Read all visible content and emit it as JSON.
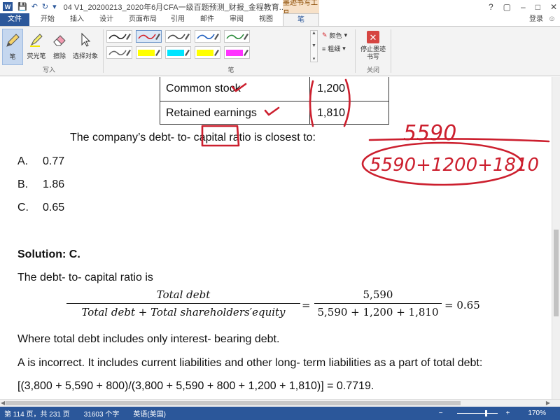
{
  "window": {
    "app_icon": "W",
    "title": "04 V1_20200213_2020年6月CFA一级百题预测_财报_金程教育...",
    "contextual_tab_group": "墨迹书写工具",
    "controls": {
      "help": "?",
      "restore": "▢",
      "minimize": "–",
      "maximize": "□",
      "close": "✕"
    }
  },
  "tabs": {
    "file": "文件",
    "items": [
      "开始",
      "插入",
      "设计",
      "页面布局",
      "引用",
      "邮件",
      "审阅",
      "视图",
      "笔"
    ],
    "login": "登录"
  },
  "ribbon": {
    "write_group": {
      "label": "写入",
      "pen": "笔",
      "highlighter": "荧光笔",
      "eraser": "擦除",
      "select": "选择对象"
    },
    "pens_group": {
      "label": "笔",
      "color": "颜色",
      "thickness": "粗细",
      "pen_colors": [
        "#222222",
        "#d42027",
        "#444444",
        "#1f5fbf",
        "#2a8a3a",
        "#666666",
        "#ffff00",
        "#00e5ff",
        "#ffff00",
        "#ff33ff"
      ]
    },
    "close_group": {
      "label": "关闭",
      "stop": "停止墨迹书写"
    }
  },
  "document": {
    "balance_sheet": [
      {
        "label": "Common stock",
        "value": "1,200"
      },
      {
        "label": "Retained earnings",
        "value": "1,810"
      }
    ],
    "question": "The company’s debt- to- capital ratio is closest to:",
    "options": [
      {
        "letter": "A.",
        "value": "0.77"
      },
      {
        "letter": "B.",
        "value": "1.86"
      },
      {
        "letter": "C.",
        "value": "0.65"
      }
    ],
    "solution_title": "Solution: C.",
    "solution_intro": "The debt- to- capital ratio is",
    "formula": {
      "num_left": "Total debt",
      "den_left": "Total debt + Total shareholders′equity",
      "num_right": "5,590",
      "den_right": "5,590 + 1,200 + 1,810",
      "equals": "=",
      "result": "= 0.65"
    },
    "note_total_debt": "Where total debt includes only interest- bearing debt.",
    "a_incorrect": "A is incorrect. It includes current liabilities and other long- term liabilities as a part of total debt:",
    "a_calc": "[(3,800 + 5,590 + 800)/(3,800 + 5,590 + 800 + 1,200 + 1,810)] = 0.7719.",
    "ink_annotations": {
      "top": "5590",
      "bottom": "5590+1200+1810"
    }
  },
  "statusbar": {
    "page": "第 114 页，共 231 页",
    "words": "31603 个字",
    "language": "英语(美国)",
    "zoom": "170%"
  },
  "colors": {
    "brand": "#2b579a",
    "ink": "#cc1f2e"
  }
}
